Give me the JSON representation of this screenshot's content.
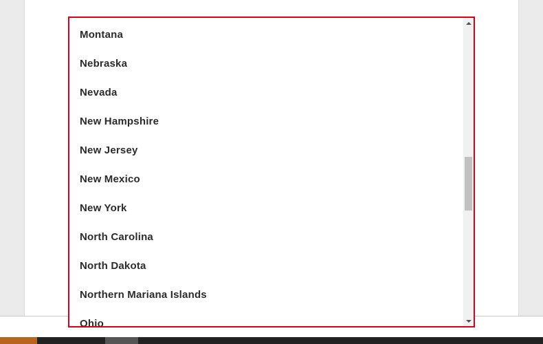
{
  "dropdown": {
    "options": [
      "Montana",
      "Nebraska",
      "Nevada",
      "New Hampshire",
      "New Jersey",
      "New Mexico",
      "New York",
      "North Carolina",
      "North Dakota",
      "Northern Mariana Islands",
      "Ohio"
    ],
    "scroll_position_fraction": 0.55
  },
  "scrollbar": {
    "up_icon": "triangle-up-icon",
    "down_icon": "triangle-down-icon"
  },
  "colors": {
    "dropdown_border": "#d9001b",
    "option_text": "#2b2b2b",
    "page_background": "#ebebeb",
    "bottom_bar": "#222222",
    "bottom_bar_accent": "#b5651d",
    "bottom_bar_gray": "#555555"
  }
}
